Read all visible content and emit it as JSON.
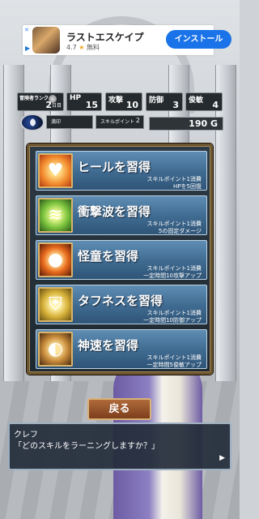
{
  "ad": {
    "close_label": "✕",
    "info_label": "▶",
    "title": "ラストエスケイプ",
    "rating": "4.7",
    "star": "★",
    "price": "無料",
    "install_label": "インストール"
  },
  "status": {
    "rank_label": "冒険者ランク",
    "rank_value": "2",
    "rank_unit": "日目",
    "hp_label": "HP",
    "hp_value": "15",
    "attack_label": "攻撃",
    "attack_value": "10",
    "defense_label": "防御",
    "defense_value": "3",
    "agility_label": "俊敏",
    "agility_value": "4",
    "mp_label": "満印",
    "skill_points_label": "スキルポイント",
    "skill_points_value": "2",
    "gold": "190 G"
  },
  "skills": [
    {
      "name": "ヒールを習得",
      "cost": "スキルポイント1消費",
      "effect": "HPを5回復",
      "icon": "heart-icon"
    },
    {
      "name": "衝撃波を習得",
      "cost": "スキルポイント1消費",
      "effect": "5の固定ダメージ",
      "icon": "shockwave-icon"
    },
    {
      "name": "怪童を習得",
      "cost": "スキルポイント1消費",
      "effect": "一定時間10攻撃アップ",
      "icon": "demon-child-icon"
    },
    {
      "name": "タフネスを習得",
      "cost": "スキルポイント1消費",
      "effect": "一定時間10防御アップ",
      "icon": "shield-icon"
    },
    {
      "name": "神速を習得",
      "cost": "スキルポイント1消費",
      "effect": "一定時間5俊敏アップ",
      "icon": "speed-icon"
    }
  ],
  "back_label": "戻る",
  "dialog": {
    "speaker": "クレフ",
    "line": "「どのスキルをラーニングしますか？」",
    "next_icon": "▶"
  }
}
